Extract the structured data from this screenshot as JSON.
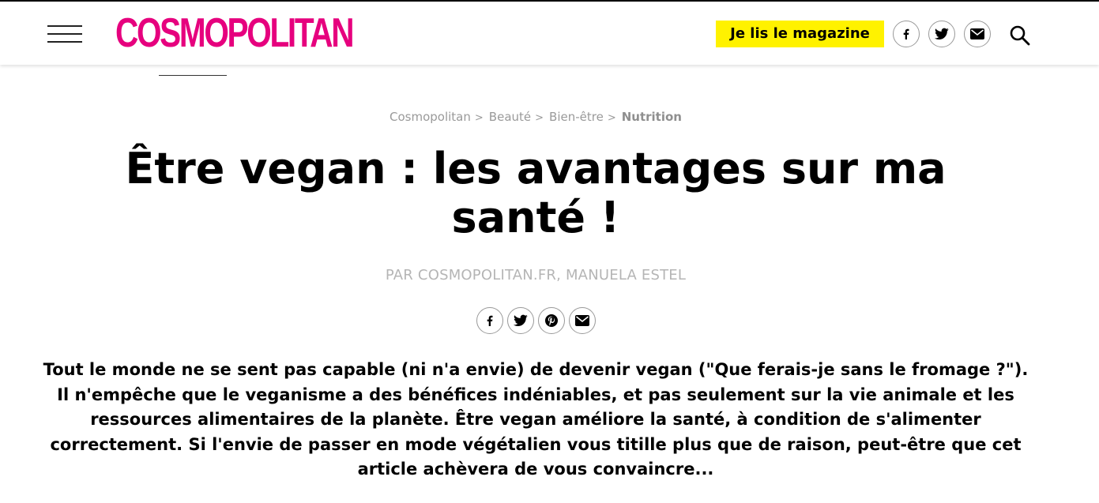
{
  "header": {
    "logo": "COSMOPOLITAN",
    "magazine_button": "Je lis le magazine",
    "social": [
      "facebook-icon",
      "twitter-icon",
      "mail-icon"
    ],
    "search_icon": "search-icon",
    "menu_icon": "hamburger-menu-icon"
  },
  "breadcrumb": {
    "items": [
      "Cosmopolitan",
      "Beauté",
      "Bien-être"
    ],
    "separator": ">",
    "current": "Nutrition"
  },
  "article": {
    "title": "Être vegan : les avantages sur ma santé !",
    "byline": "PAR COSMOPOLITAN.FR, MANUELA ESTEL",
    "share": [
      "facebook-icon",
      "twitter-icon",
      "pinterest-icon",
      "mail-icon"
    ],
    "lead": "Tout le monde ne se sent pas capable (ni n'a envie) de devenir vegan (\"Que ferais-je sans le fromage ?\"). Il n'empêche que le veganisme a des bénéfices indéniables, et pas seulement sur la vie animale et les ressources alimentaires de la planète. Être vegan améliore la santé, à condition de s'alimenter correctement. Si l'envie de passer en mode végétalien vous titille plus que de raison, peut-être que cet article achèvera de vous convaincre..."
  },
  "colors": {
    "brand": "#e6007e",
    "magazine_button_bg": "#fff200",
    "muted_text": "#9a9a9a"
  }
}
